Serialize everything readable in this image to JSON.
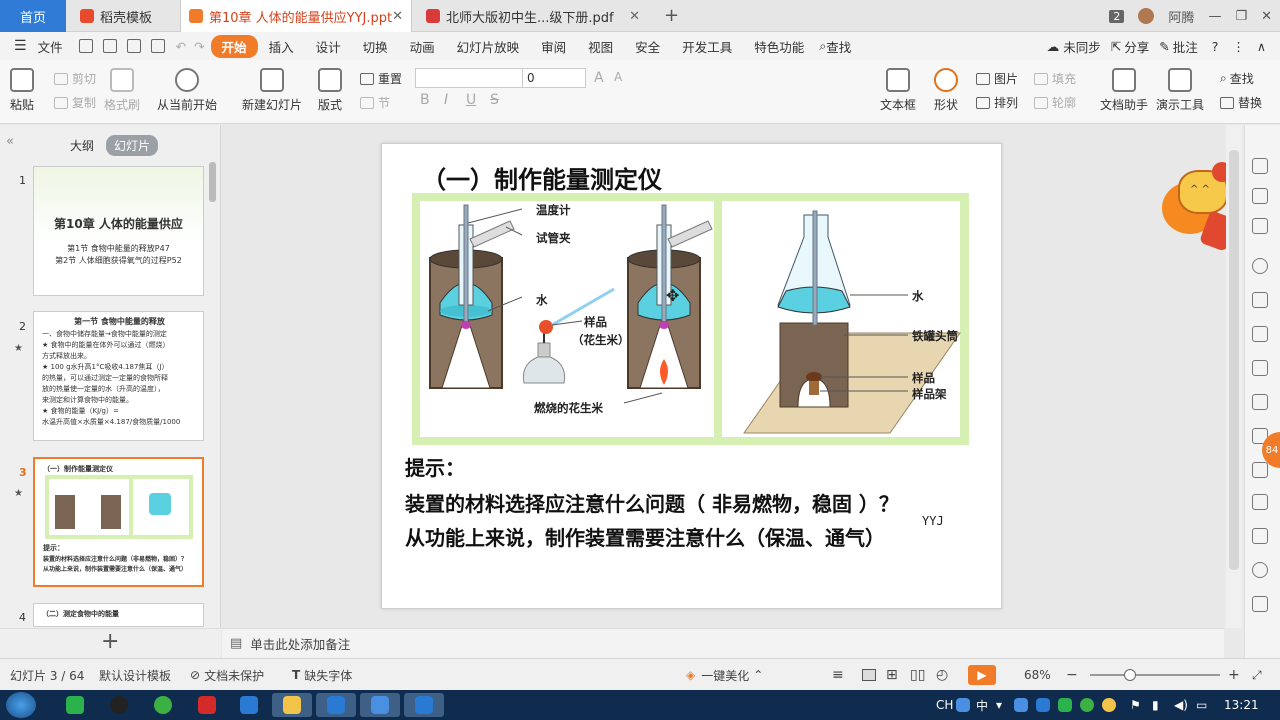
{
  "tabs": [
    {
      "label": "首页"
    },
    {
      "label": "稻壳模板"
    },
    {
      "label": "第10章 人体的能量供应YYJ.ppt"
    },
    {
      "label": "北师大版初中生...级下册.pdf"
    }
  ],
  "tab_add": "+",
  "window": {
    "badge": "2",
    "user": "阿腾"
  },
  "menu": {
    "file": "文件",
    "items": [
      "开始",
      "插入",
      "设计",
      "切换",
      "动画",
      "幻灯片放映",
      "审阅",
      "视图",
      "安全",
      "开发工具",
      "特色功能"
    ],
    "search": "查找",
    "sync": "未同步",
    "share": "分享",
    "comment": "批注"
  },
  "ribbon": {
    "paste": "粘贴",
    "cut": "剪切",
    "copy": "复制",
    "format_painter": "格式刷",
    "from_current": "从当前开始",
    "new_slide": "新建幻灯片",
    "layout": "版式",
    "reset": "重置",
    "section": "节",
    "font_size": "0",
    "textbox": "文本框",
    "shape": "形状",
    "picture": "图片",
    "arrange": "排列",
    "fill": "填充",
    "outline": "轮廓",
    "doc_helper": "文档助手",
    "present_tool": "演示工具",
    "find": "查找",
    "replace": "替换"
  },
  "left_panel": {
    "view_outline": "大纲",
    "view_slides": "幻灯片",
    "thumbs": [
      {
        "num": "1",
        "title": "第10章 人体的能量供应",
        "lines": [
          "第1节 食物中能量的释放P47",
          "第2节 人体细胞获得氧气的过程P52"
        ]
      },
      {
        "num": "2",
        "title": "第一节   食物中能量的释放",
        "lines": [
          "一、食物中储存能量→食物中能量的测定",
          "★  食物中的能量在体外可以通过（燃烧）",
          "方式释放出来。",
          "★  100 g水升高1°C吸收4.187焦耳（J）",
          "的热量，可以通过测定一定量的食物所释",
          "放的热量使一定量的水（升高的温度），",
          "来测定和计算食物中的能量。",
          "★  食物的能量（KJ/g）=",
          "水温升高值×水质量×4.187/食物质量/1000"
        ]
      },
      {
        "num": "3",
        "title": "（一）制作能量测定仪",
        "lines": [
          "提示：",
          "装置的材料选择应注意什么问题（非易燃物，稳固）？",
          "从功能上来说，制作装置需要注意什么（保温、通气）"
        ]
      },
      {
        "num": "4",
        "title": "（二）测定食物中的能量",
        "lines": []
      }
    ],
    "add": "+"
  },
  "slide": {
    "title": "（一）制作能量测定仪",
    "labels": {
      "thermometer": "温度计",
      "clamp": "试管夹",
      "water": "水",
      "sample": "样品",
      "peanut": "（花生米）",
      "burning": "燃烧的花生米",
      "water2": "水",
      "can": "铁罐头筒",
      "sample2": "样品",
      "rack": "样品架"
    },
    "hint_title": "提示：",
    "hint1": "装置的材料选择应注意什么问题（ 非易燃物，稳固 ）？",
    "hint2": "从功能上来说，制作装置需要注意什么（保温、通气）",
    "scribble": "YYJ"
  },
  "notes_placeholder": "单击此处添加备注",
  "status": {
    "slide_info": "幻灯片 3 / 64",
    "template": "默认设计模板",
    "protect": "文档未保护",
    "missing_font": "缺失字体",
    "beautify": "一键美化",
    "zoom": "68%",
    "zoom_level": 0.68,
    "minus": "−",
    "plus": "+"
  },
  "sidebar_badge": "84",
  "taskbar": {
    "ime": "CH",
    "ime2": "中",
    "clock": "13:21"
  },
  "colors": {
    "accent": "#f07c2a",
    "home_tab": "#2f7bd6",
    "taskbar": "#0f2b4d",
    "slide_green": "#d6f0b4"
  }
}
